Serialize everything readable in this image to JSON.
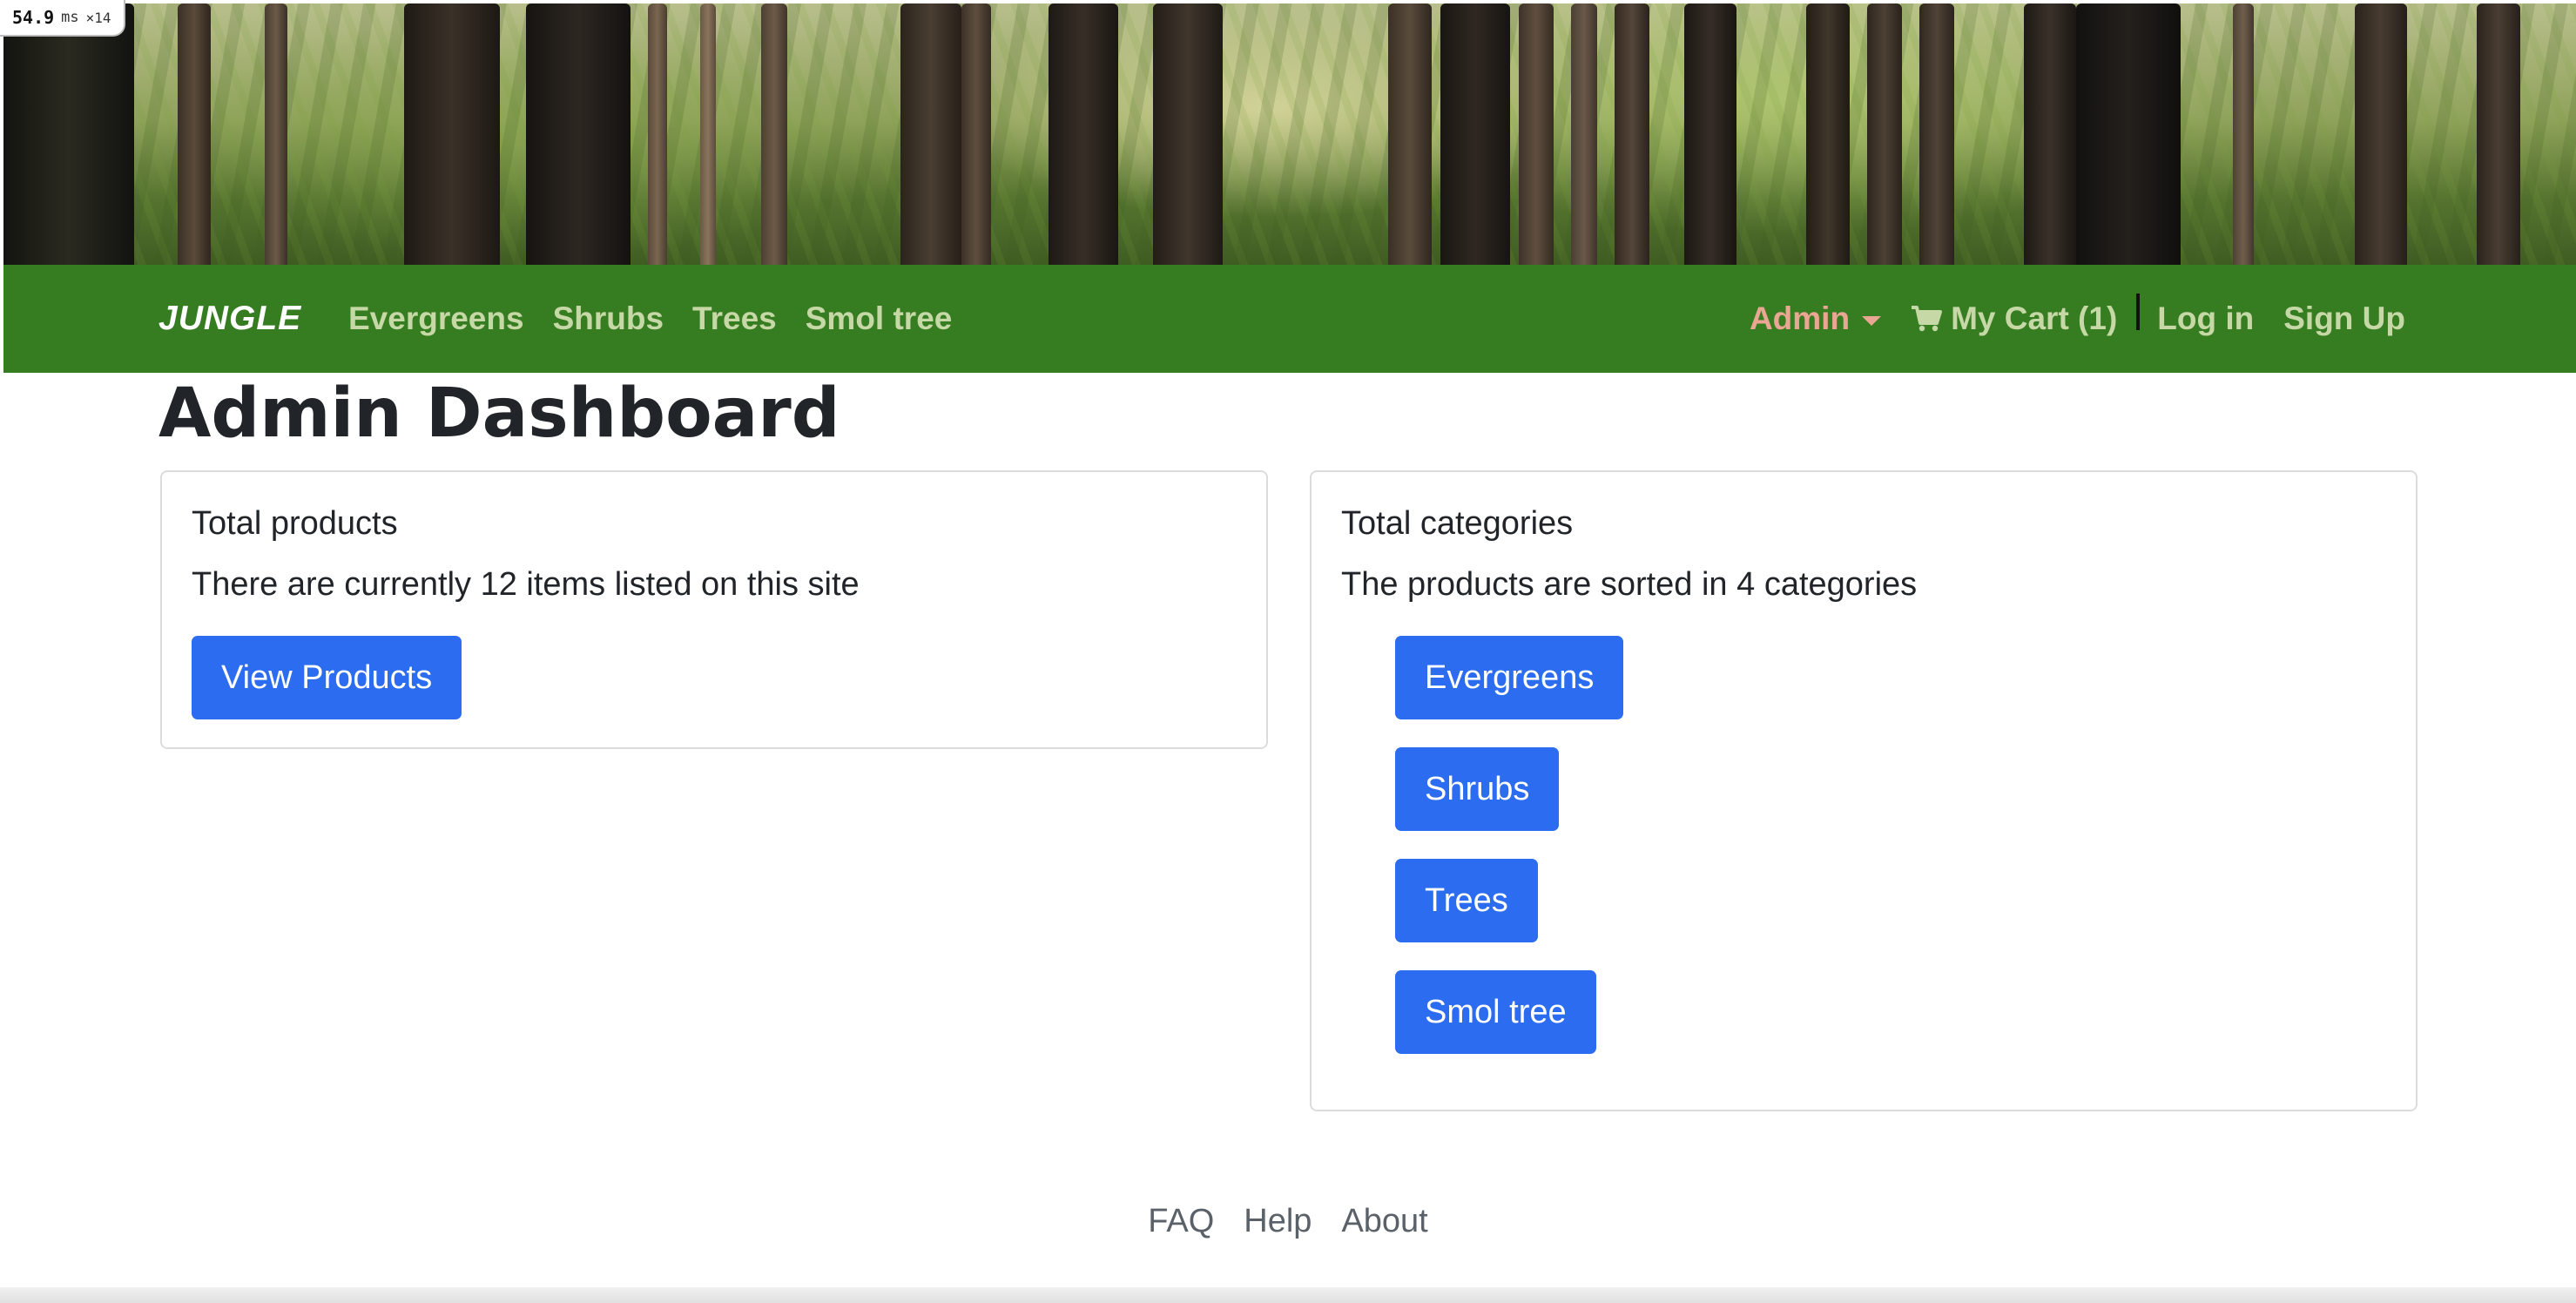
{
  "perf_overlay": {
    "value": "54.9",
    "unit": "ms",
    "multiplier": "×14"
  },
  "navbar": {
    "brand": "JUNGLE",
    "categories": [
      "Evergreens",
      "Shrubs",
      "Trees",
      "Smol tree"
    ],
    "admin_label": "Admin",
    "cart_label": "My Cart (1)",
    "login_label": "Log in",
    "signup_label": "Sign Up"
  },
  "main": {
    "title": "Admin Dashboard",
    "products_card": {
      "title": "Total products",
      "text": "There are currently 12 items listed on this site",
      "button_label": "View Products"
    },
    "categories_card": {
      "title": "Total categories",
      "text": "The products are sorted in 4 categories",
      "buttons": [
        "Evergreens",
        "Shrubs",
        "Trees",
        "Smol tree"
      ]
    }
  },
  "footer": {
    "links": [
      "FAQ",
      "Help",
      "About"
    ]
  },
  "colors": {
    "navbar_bg": "#367d22",
    "nav_link": "#c5d8a6",
    "admin_link": "#e9a692",
    "button_bg": "#2b6cf0"
  },
  "icons": {
    "cart": "shopping-cart-icon",
    "dropdown": "caret-down-icon"
  }
}
